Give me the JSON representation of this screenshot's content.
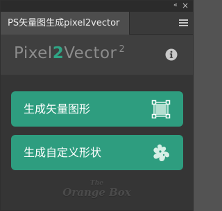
{
  "window": {
    "collapse_glyph": "«",
    "close_glyph": "×"
  },
  "tab": {
    "label": "PS矢量图生成pixel2vector",
    "menu_icon": "hamburger-menu-icon"
  },
  "header": {
    "logo_prefix": "Pixel",
    "logo_num": "2",
    "logo_suffix": "Vector",
    "logo_sup": "2",
    "info_icon": "info-icon"
  },
  "buttons": [
    {
      "label": "生成矢量图形",
      "icon": "vector-frame-icon"
    },
    {
      "label": "生成自定义形状",
      "icon": "custom-shape-icon"
    }
  ],
  "brand": {
    "line1": "The",
    "line2": "Orange Box"
  },
  "colors": {
    "accent": "#2e9d7f",
    "logo_accent": "#2fa585",
    "panel_bg": "#353535",
    "header_bg": "#3f3f3f",
    "tab_bg": "#4d4d4d"
  }
}
